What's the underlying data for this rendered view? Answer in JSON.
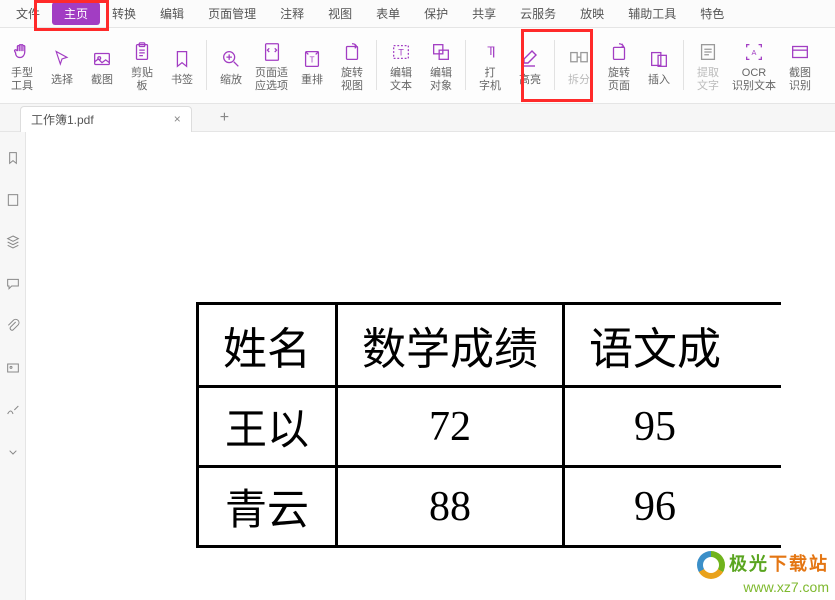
{
  "menu": {
    "items": [
      "文件",
      "主页",
      "转换",
      "编辑",
      "页面管理",
      "注释",
      "视图",
      "表单",
      "保护",
      "共享",
      "云服务",
      "放映",
      "辅助工具",
      "特色"
    ],
    "active_index": 1
  },
  "toolbar": {
    "hand": "手型\n工具",
    "select": "选择",
    "snapshot": "截图",
    "clipboard": "剪贴\n板",
    "bookmark": "书签",
    "zoom": "缩放",
    "fit": "页面适\n应选项",
    "reflow": "重排",
    "rotate_view": "旋转\n视图",
    "edit_text": "编辑\n文本",
    "edit_obj": "编辑\n对象",
    "typewriter": "打\n字机",
    "highlight": "高亮",
    "split": "拆分",
    "rotate_page": "旋转\n页面",
    "insert": "插入",
    "extract": "提取\n文字",
    "ocr": "OCR\n识别文本",
    "screen": "截图\n识别"
  },
  "tab": {
    "name": "工作簿1.pdf"
  },
  "table": {
    "headers": [
      "姓名",
      "数学成绩",
      "语文成"
    ],
    "rows": [
      [
        "王以",
        "72",
        "95"
      ],
      [
        "青云",
        "88",
        "96"
      ]
    ]
  },
  "watermark": {
    "brand1": "极光",
    "brand2": "下载站",
    "url": "www.xz7.com"
  }
}
